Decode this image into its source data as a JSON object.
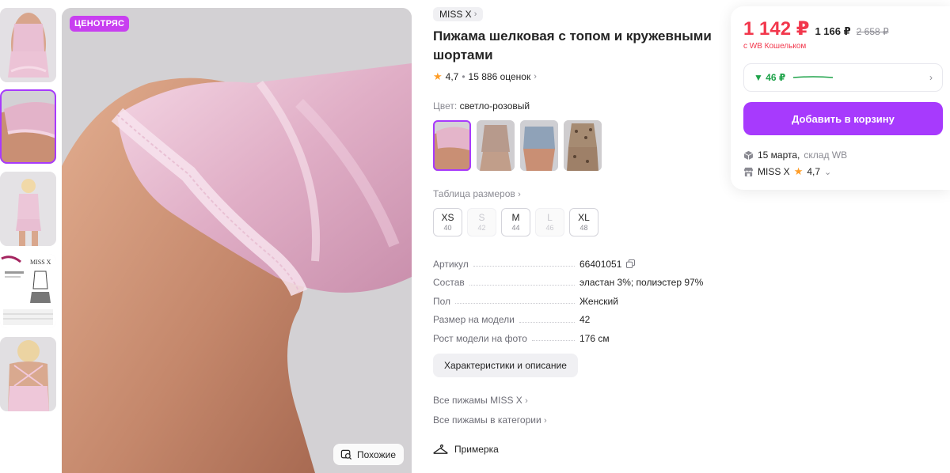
{
  "thumbnails": [
    {
      "name": "thumb-front"
    },
    {
      "name": "thumb-back-shorts"
    },
    {
      "name": "thumb-model-full"
    },
    {
      "name": "thumb-infographic",
      "brand": "MISS X"
    },
    {
      "name": "thumb-back-straps"
    }
  ],
  "main_image": {
    "badge": "ЦЕНОТРЯС",
    "similar_label": "Похожие"
  },
  "product": {
    "brand": "MISS X",
    "title": "Пижама шелковая с топом и кружевными шортами",
    "rating": "4,7",
    "reviews": "15 886 оценок",
    "color_label": "Цвет:",
    "color_value": "светло-розовый",
    "size_table_label": "Таблица размеров",
    "sizes": [
      {
        "name": "XS",
        "num": "40",
        "available": true
      },
      {
        "name": "S",
        "num": "42",
        "available": false
      },
      {
        "name": "M",
        "num": "44",
        "available": true
      },
      {
        "name": "L",
        "num": "46",
        "available": false
      },
      {
        "name": "XL",
        "num": "48",
        "available": true
      }
    ],
    "params": [
      {
        "key": "Артикул",
        "value": "66401051"
      },
      {
        "key": "Состав",
        "value": "эластан 3%; полиэстер 97%"
      },
      {
        "key": "Пол",
        "value": "Женский"
      },
      {
        "key": "Размер на модели",
        "value": "42"
      },
      {
        "key": "Рост модели на фото",
        "value": "176 см"
      }
    ],
    "details_button": "Характеристики и описание",
    "link_all_brand": "Все пижамы MISS X",
    "link_all_category": "Все пижамы в категории",
    "fitting_label": "Примерка"
  },
  "price_card": {
    "price": "1 142 ₽",
    "price_no_wallet": "1 166 ₽",
    "price_old": "2 658 ₽",
    "wallet_note": "с WB Кошельком",
    "cashback": "▼ 46 ₽",
    "add_to_cart": "Добавить в корзину",
    "delivery_date": "15 марта,",
    "delivery_warehouse": "склад WB",
    "seller": "MISS X",
    "seller_rating": "4,7"
  },
  "colors": {
    "accent": "#a73afd",
    "price_red": "#f2374c",
    "cashback_green": "#1fa34a",
    "badge": "#c83ff0"
  }
}
